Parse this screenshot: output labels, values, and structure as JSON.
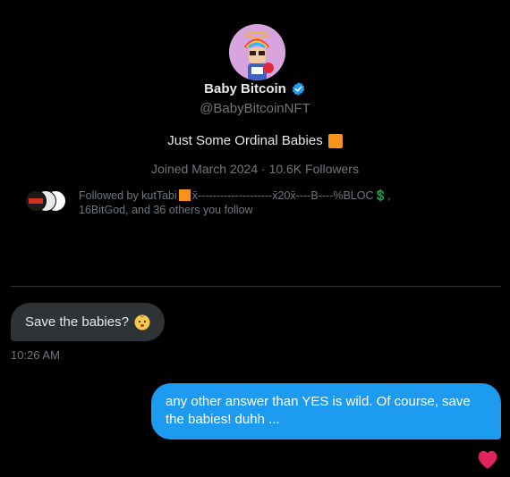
{
  "profile": {
    "name": "Baby Bitcoin",
    "handle": "@BabyBitcoinNFT",
    "bio": "Just Some Ordinal Babies",
    "meta": "Joined March 2024 · 10.6K Followers",
    "followed_by_prefix": "Followed by kutTabi",
    "followed_by_rest": "x̄--------------------x̄20x̄----B----%BLOC💲,",
    "followed_by_line2": "16BitGod, and 36 others you follow"
  },
  "messages": {
    "incoming": {
      "text": "Save the babies?",
      "time": "10:26 AM"
    },
    "outgoing": {
      "text": "any other answer than YES is wild. Of course, save the babies! duhh ..."
    }
  },
  "colors": {
    "background": "#000000",
    "accent": "#1d9bf0",
    "incoming_bubble": "#2f3336",
    "bitcoin_orange": "#f7931a",
    "heart": "#f91880"
  },
  "icons": [
    "verified-badge-icon",
    "baby-emoji-icon",
    "heart-reaction-icon"
  ]
}
